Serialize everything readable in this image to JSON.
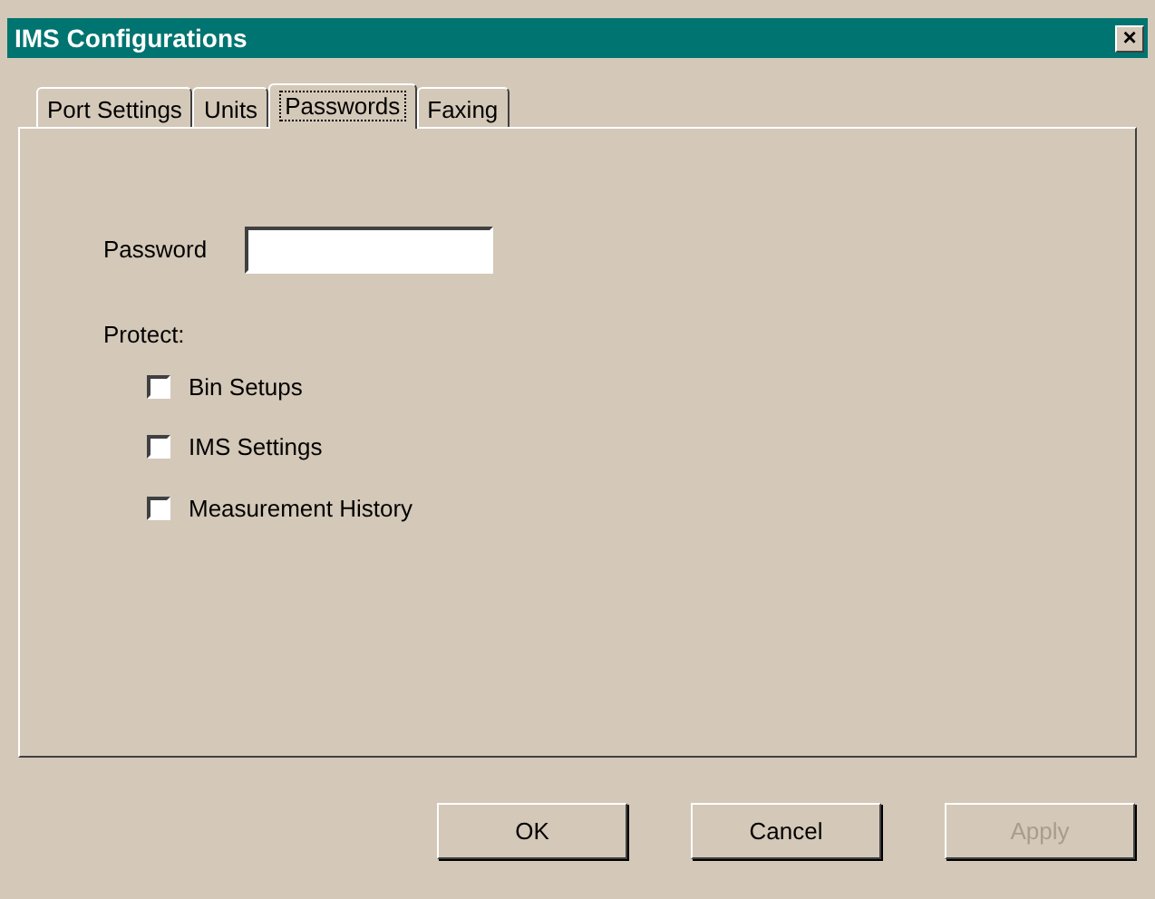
{
  "window": {
    "title": "IMS Configurations",
    "close": "×"
  },
  "tabs": [
    {
      "label": "Port Settings",
      "selected": false
    },
    {
      "label": "Units",
      "selected": false
    },
    {
      "label": "Passwords",
      "selected": true
    },
    {
      "label": "Faxing",
      "selected": false
    }
  ],
  "password": {
    "label": "Password"
  },
  "protect": {
    "label": "Protect:",
    "items": [
      {
        "label": "Bin Setups",
        "checked": false
      },
      {
        "label": "IMS Settings",
        "checked": false
      },
      {
        "label": "Measurement History",
        "checked": false
      }
    ]
  },
  "buttons": [
    {
      "label": "OK",
      "disabled": false
    },
    {
      "label": "Cancel",
      "disabled": false
    },
    {
      "label": "Apply",
      "disabled": true
    }
  ]
}
